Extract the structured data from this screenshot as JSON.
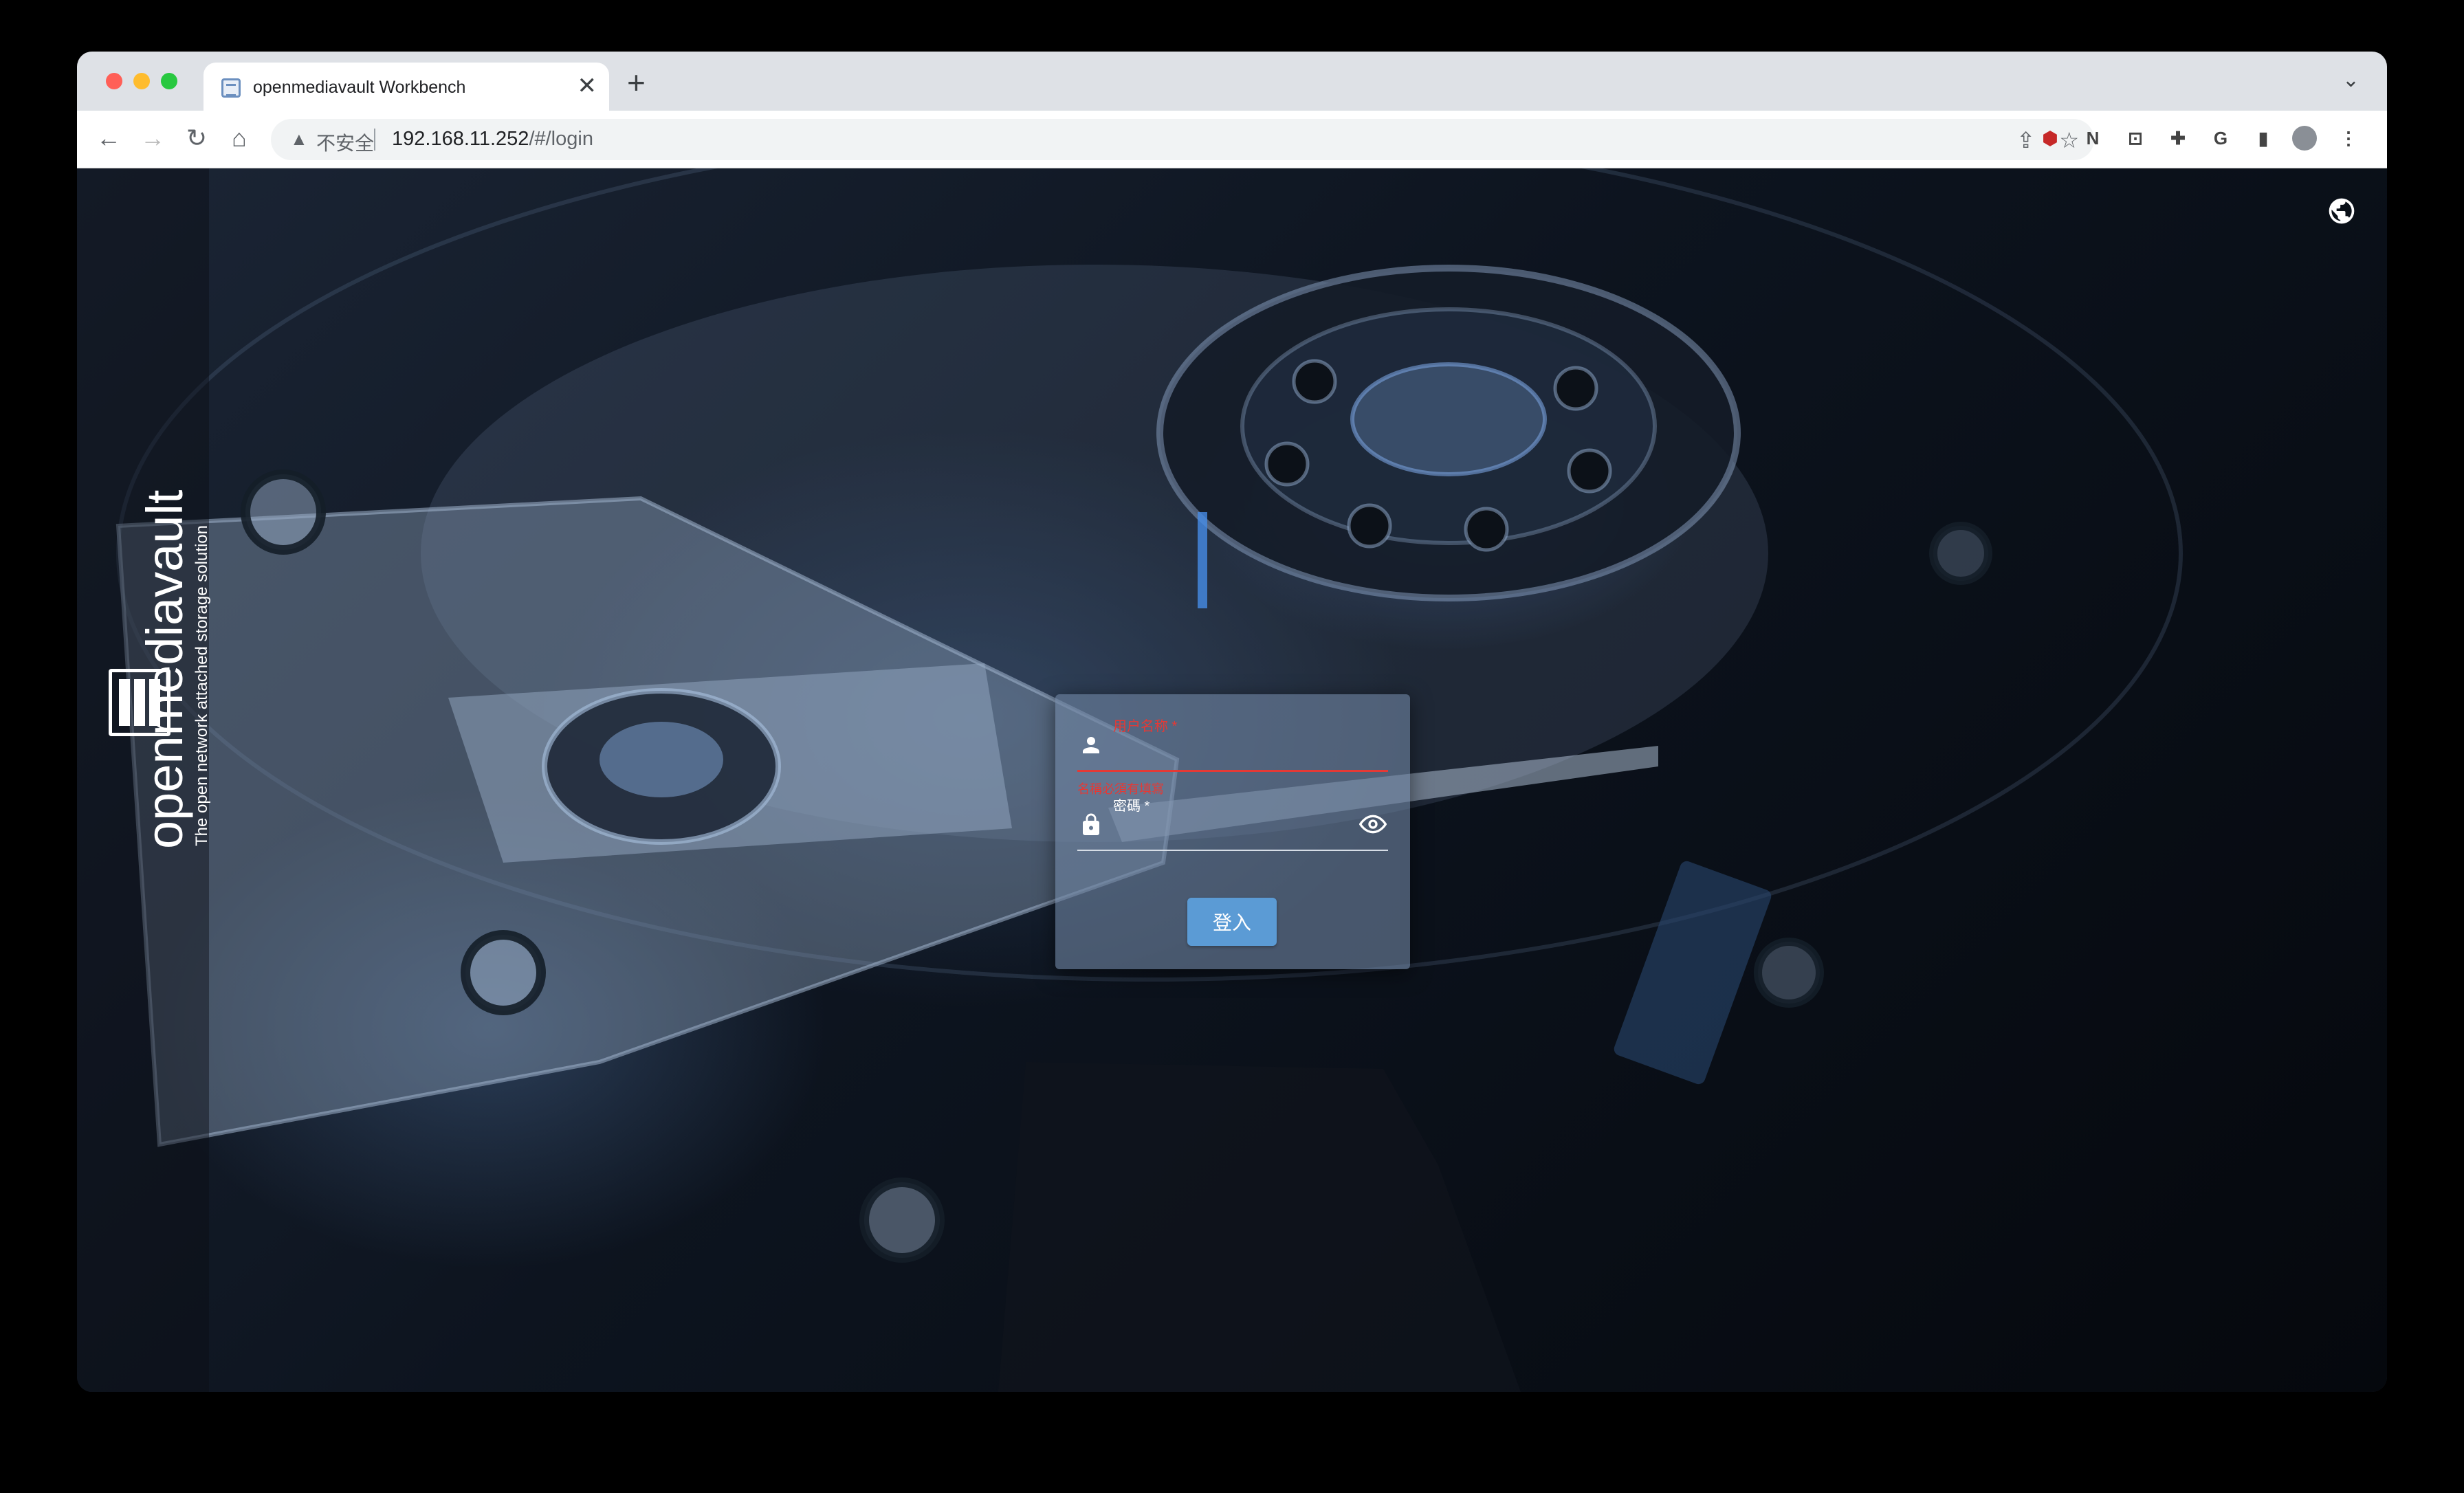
{
  "browser": {
    "tab_title": "openmediavault Workbench",
    "tab_close": "✕",
    "new_tab": "+",
    "security_label": "不安全",
    "url_host": "192.168.11.252",
    "url_path": "/#/login"
  },
  "sidebar": {
    "brand_name": "openmediavault",
    "brand_tagline": "The open network attached storage solution"
  },
  "login": {
    "username_label": "用户名称 *",
    "username_value": "",
    "username_error": "名稱必須有填寫",
    "password_label": "密碼 *",
    "password_value": "",
    "submit_label": "登入"
  },
  "colors": {
    "accent": "#5b9bd5",
    "error": "#e53935"
  },
  "icons": [
    "globe-icon",
    "user-icon",
    "lock-icon",
    "eye-icon"
  ]
}
